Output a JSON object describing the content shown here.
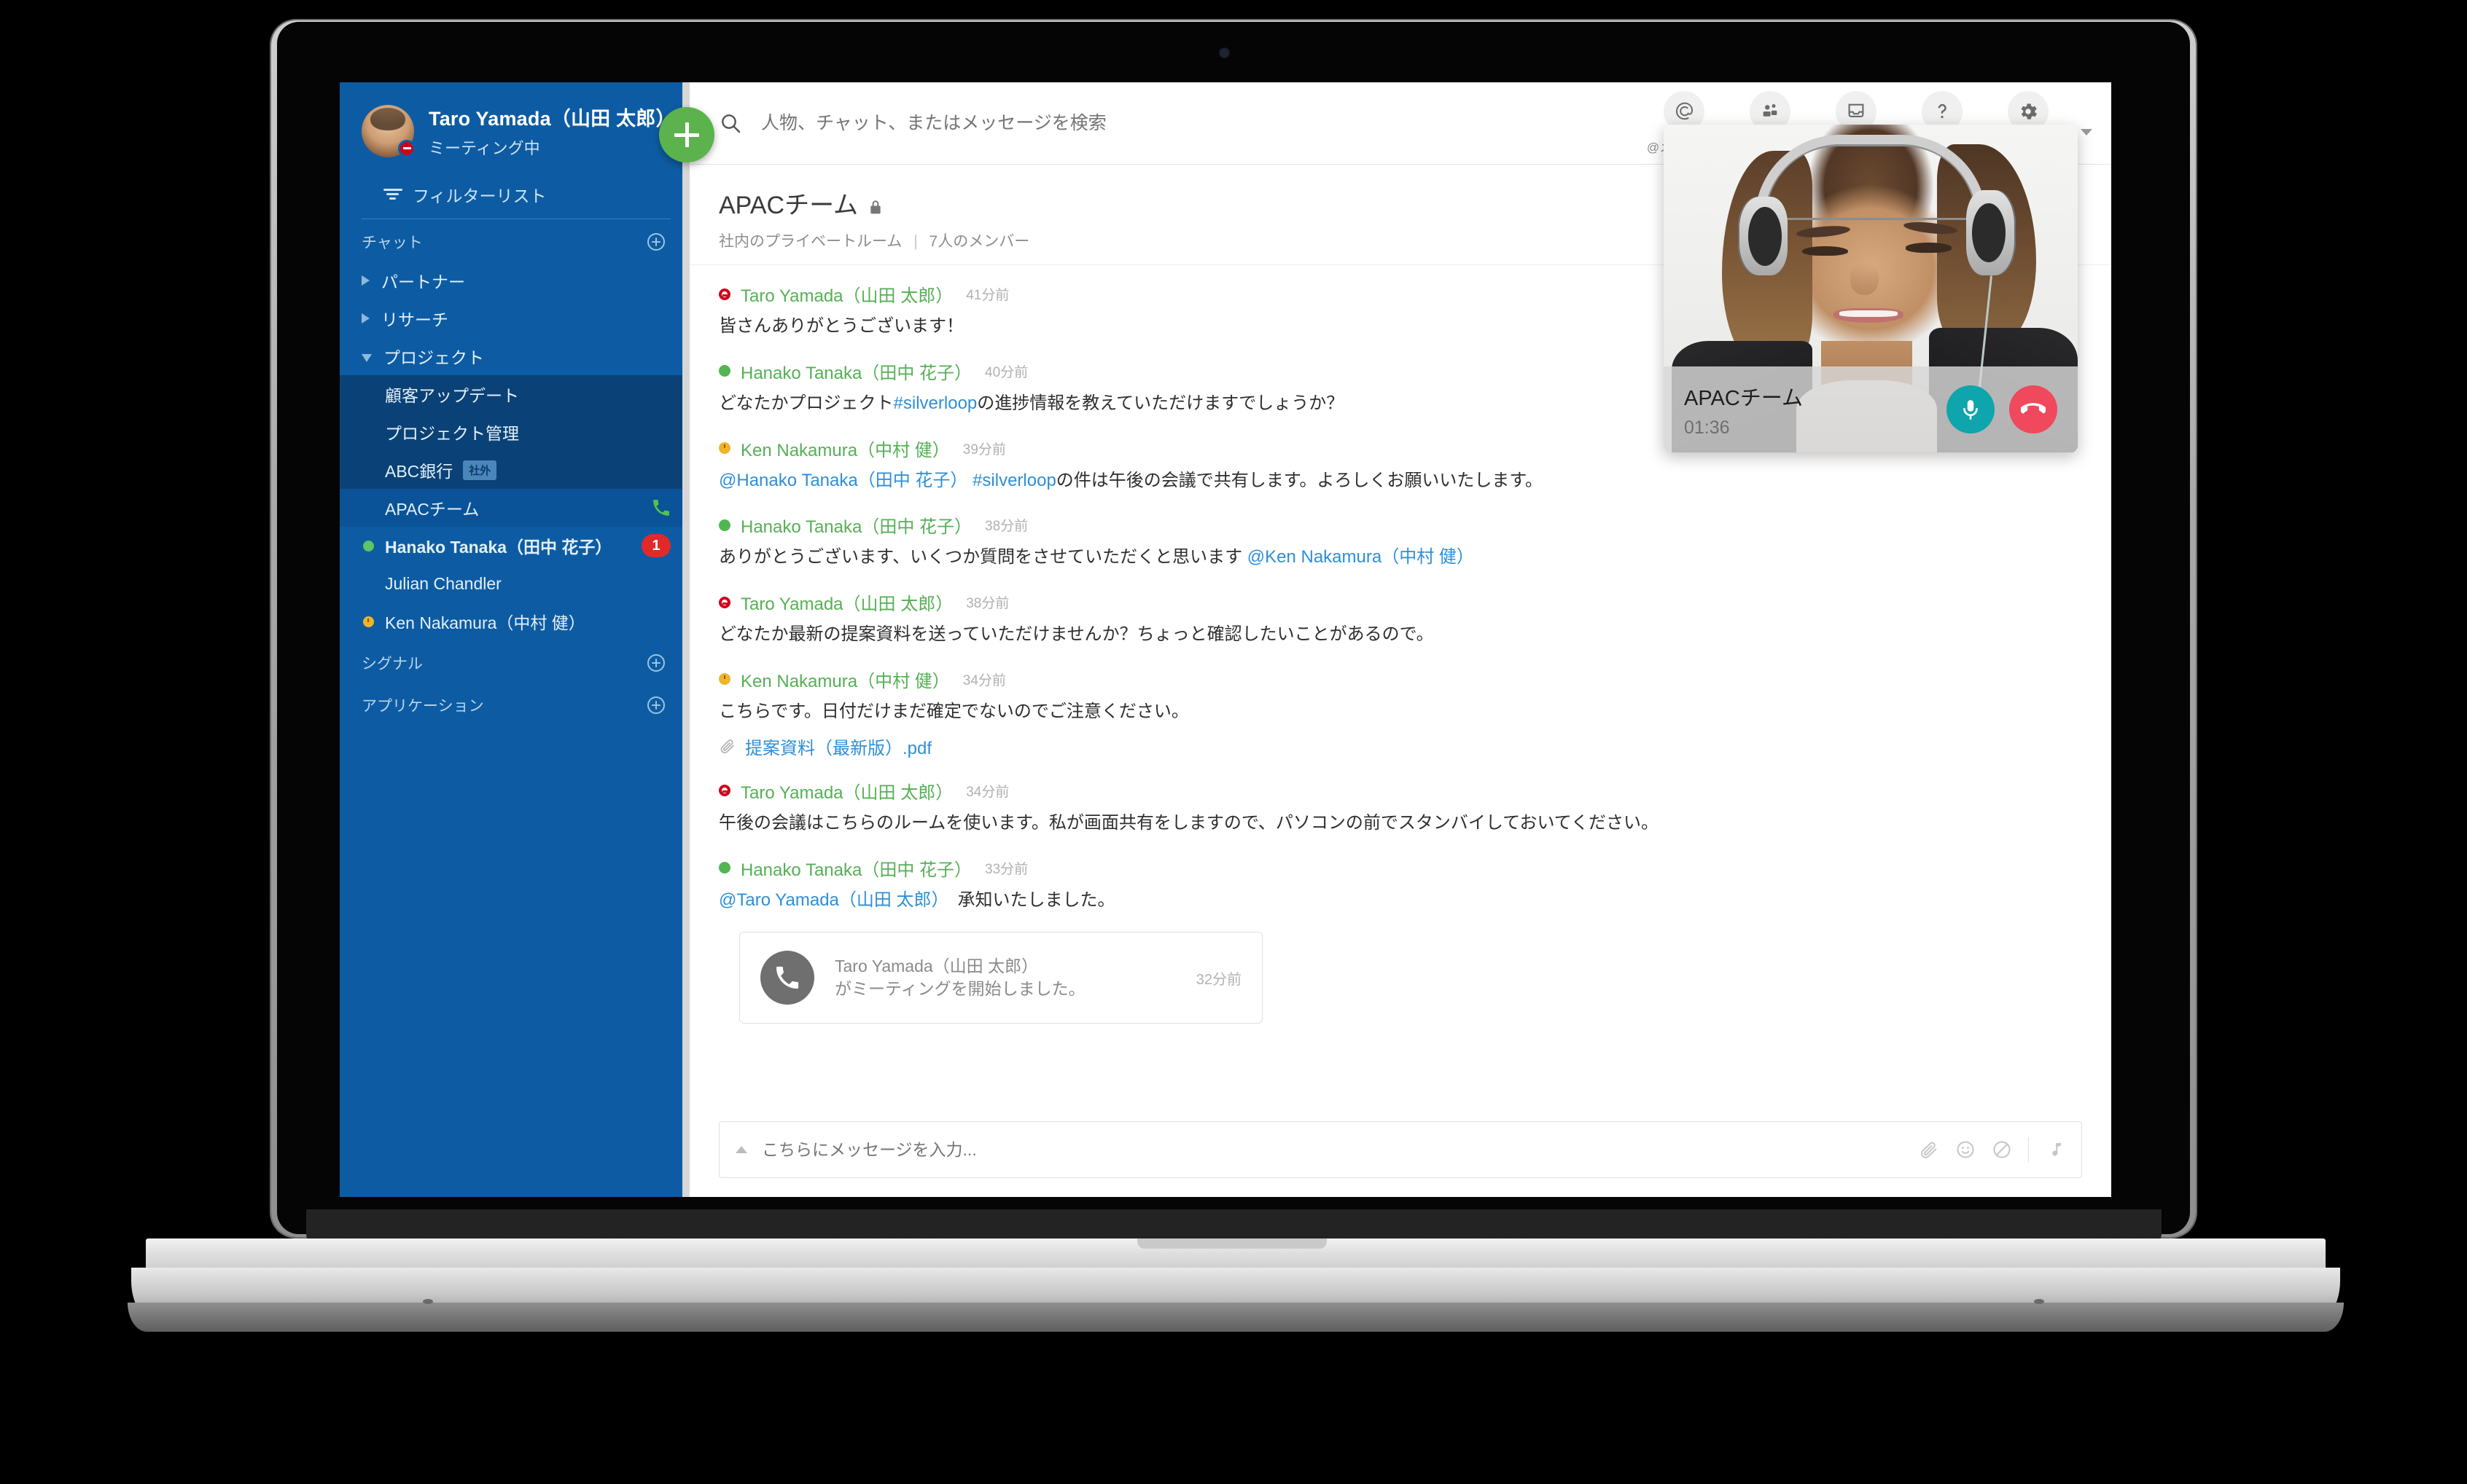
{
  "sidebar": {
    "profile": {
      "name": "Taro Yamada（山田 太郎）",
      "status_text": "ミーティング中",
      "status_type": "busy"
    },
    "add_button_label": "+",
    "filter": {
      "label": "フィルターリスト"
    },
    "sections": [
      {
        "key": "chat",
        "label": "チャット"
      },
      {
        "key": "signal",
        "label": "シグナル"
      },
      {
        "key": "apps",
        "label": "アプリケーション"
      }
    ],
    "folders": [
      {
        "label": "パートナー",
        "expanded": false
      },
      {
        "label": "リサーチ",
        "expanded": false
      },
      {
        "label": "プロジェクト",
        "expanded": true
      }
    ],
    "rooms": [
      {
        "label": "顧客アップデート",
        "nested": true,
        "presence": "none",
        "badge_ext": "",
        "unread": "",
        "calling": false,
        "bold": false
      },
      {
        "label": "プロジェクト管理",
        "nested": true,
        "presence": "none",
        "badge_ext": "",
        "unread": "",
        "calling": false,
        "bold": false
      },
      {
        "label": "ABC銀行",
        "nested": true,
        "presence": "none",
        "badge_ext": "社外",
        "unread": "",
        "calling": false,
        "bold": false
      },
      {
        "label": "APACチーム",
        "nested": false,
        "presence": "none",
        "badge_ext": "",
        "unread": "",
        "calling": true,
        "bold": false,
        "active": true
      },
      {
        "label": "Hanako Tanaka（田中 花子）",
        "nested": false,
        "presence": "available",
        "badge_ext": "",
        "unread": "1",
        "calling": false,
        "bold": true
      },
      {
        "label": "Julian Chandler",
        "nested": false,
        "presence": "none",
        "badge_ext": "",
        "unread": "",
        "calling": false,
        "bold": false
      },
      {
        "label": "Ken Nakamura（中村 健）",
        "nested": false,
        "presence": "away",
        "badge_ext": "",
        "unread": "",
        "calling": false,
        "bold": false
      }
    ]
  },
  "topbar": {
    "search_placeholder": "人物、チャット、またはメッセージを検索",
    "search_value": "",
    "actions": [
      {
        "icon": "at-mention-icon",
        "label": "@メンション"
      },
      {
        "icon": "community-people-icon",
        "label": "コミュニティ"
      },
      {
        "icon": "inbox-tray-icon",
        "label": "受信箱"
      },
      {
        "icon": "help-question-icon",
        "label": "ヘルプ"
      },
      {
        "icon": "gear-settings-icon",
        "label": "設定"
      }
    ]
  },
  "room_header": {
    "title": "APACチーム",
    "privacy_icon": "lock-icon",
    "subtitle_type": "社内のプライベートルーム",
    "subtitle_divider": "|",
    "subtitle_members": "7人のメンバー"
  },
  "messages": [
    {
      "author": "Taro Yamada（山田 太郎）",
      "presence": "busy",
      "time": "41分前",
      "segments": [
        {
          "t": "皆さんありがとうございます！",
          "k": "plain"
        }
      ]
    },
    {
      "author": "Hanako Tanaka（田中 花子）",
      "presence": "available",
      "time": "40分前",
      "segments": [
        {
          "t": "どなたかプロジェクト",
          "k": "plain"
        },
        {
          "t": "#silverloop",
          "k": "hashtag"
        },
        {
          "t": "の進捗情報を教えていただけますでしょうか？",
          "k": "plain"
        }
      ]
    },
    {
      "author": "Ken Nakamura（中村 健）",
      "presence": "away",
      "time": "39分前",
      "segments": [
        {
          "t": "@Hanako Tanaka（田中 花子）",
          "k": "mention"
        },
        {
          "t": " ",
          "k": "plain"
        },
        {
          "t": "#silverloop",
          "k": "hashtag"
        },
        {
          "t": "の件は午後の会議で共有します。よろしくお願いいたします。",
          "k": "plain"
        }
      ]
    },
    {
      "author": "Hanako Tanaka（田中 花子）",
      "presence": "available",
      "time": "38分前",
      "segments": [
        {
          "t": "ありがとうございます、いくつか質問をさせていただくと思います ",
          "k": "plain"
        },
        {
          "t": "@Ken Nakamura（中村 健）",
          "k": "mention"
        }
      ]
    },
    {
      "author": "Taro Yamada（山田 太郎）",
      "presence": "busy",
      "time": "38分前",
      "segments": [
        {
          "t": "どなたか最新の提案資料を送っていただけませんか？ちょっと確認したいことがあるので。",
          "k": "plain"
        }
      ]
    },
    {
      "author": "Ken Nakamura（中村 健）",
      "presence": "away",
      "time": "34分前",
      "segments": [
        {
          "t": "こちらです。日付だけまだ確定でないのでご注意ください。",
          "k": "plain"
        }
      ],
      "attachment": {
        "icon": "paperclip-icon",
        "name": "提案資料（最新版）.pdf"
      }
    },
    {
      "author": "Taro Yamada（山田 太郎）",
      "presence": "busy",
      "time": "34分前",
      "segments": [
        {
          "t": "午後の会議はこちらのルームを使います。私が画面共有をしますので、パソコンの前でスタンバイしておいてください。",
          "k": "plain"
        }
      ]
    },
    {
      "author": "Hanako Tanaka（田中 花子）",
      "presence": "available",
      "time": "33分前",
      "segments": [
        {
          "t": "@Taro Yamada（山田 太郎）",
          "k": "mention"
        },
        {
          "t": "　承知いたしました。",
          "k": "plain"
        }
      ]
    }
  ],
  "meeting_card": {
    "icon": "phone-icon",
    "actor": "Taro Yamada（山田 太郎）",
    "text": "がミーティングを開始しました。",
    "time": "32分前"
  },
  "composer": {
    "placeholder": "こちらにメッセージを入力...",
    "value": "",
    "icons": [
      {
        "icon": "paperclip-icon"
      },
      {
        "icon": "emoji-smiley-icon"
      },
      {
        "icon": "do-not-disturb-icon"
      },
      {
        "icon": "music-note-icon"
      }
    ]
  },
  "call_panel": {
    "room": "APACチーム",
    "timer": "01:36",
    "mic_icon": "microphone-icon",
    "end_icon": "end-call-icon"
  },
  "colors": {
    "sidebar_bg": "#0d5ca3",
    "sidebar_nested_bg": "#0a4277",
    "sidebar_active_bg": "#0a5398",
    "accent_green": "#5cb24d",
    "author_green": "#55b055",
    "link_blue": "#2e8fd6",
    "unread_red": "#e02a2a",
    "mic_teal": "#0ea5ad",
    "end_red": "#f0485c",
    "status_busy": "#d0021b",
    "status_available": "#52b552",
    "status_away": "#f0b429"
  }
}
